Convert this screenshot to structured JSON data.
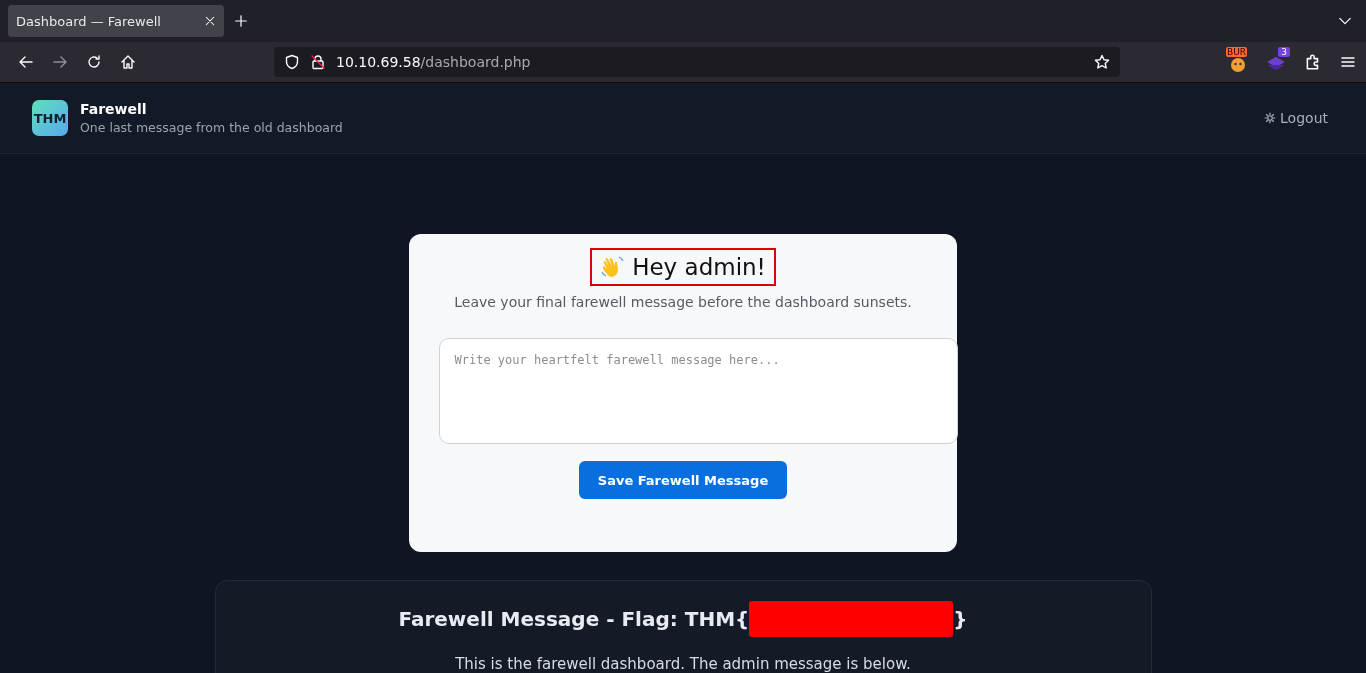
{
  "browser": {
    "tabs": [
      {
        "title": "Dashboard — Farewell",
        "selected": true
      }
    ],
    "address": {
      "host": "10.10.69.58",
      "path": "/dashboard.php"
    },
    "extension_badge": "3",
    "burp_label": "BUR"
  },
  "header": {
    "logo": "THM",
    "title": "Farewell",
    "subtitle": "One last message from the old dashboard",
    "logout": "Logout"
  },
  "card": {
    "greeting": "Hey admin!",
    "greeting_highlighted": true,
    "intro": "Leave your final farewell message before the dashboard sunsets.",
    "message": {
      "placeholder": "Write your heartfelt farewell message here..."
    },
    "save_button": "Save Farewell Message"
  },
  "flag_panel": {
    "heading_prefix": "Farewell Message - Flag: THM{",
    "redacted": true,
    "heading_suffix": "}",
    "text": "This is the farewell dashboard. The admin message is below."
  }
}
